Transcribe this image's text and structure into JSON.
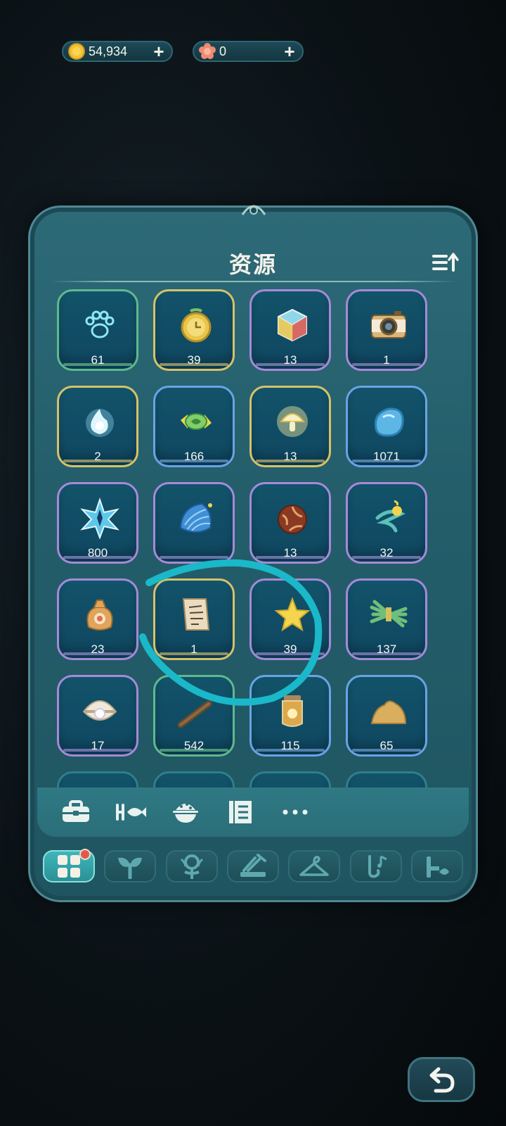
{
  "currencies": [
    {
      "name": "gold-coin",
      "value": "54,934",
      "icon": "coin-icon"
    },
    {
      "name": "flower-token",
      "value": "0",
      "icon": "flower-icon"
    }
  ],
  "panel": {
    "title": "资源",
    "items": [
      {
        "icon": "paw-icon",
        "count": "61",
        "rarity": "green"
      },
      {
        "icon": "pocket-watch-icon",
        "count": "39",
        "rarity": "yellow"
      },
      {
        "icon": "cube-icon",
        "count": "13",
        "rarity": "purple"
      },
      {
        "icon": "camera-icon",
        "count": "1",
        "rarity": "purple"
      },
      {
        "icon": "spirit-flame-icon",
        "count": "2",
        "rarity": "yellow"
      },
      {
        "icon": "candy-icon",
        "count": "166",
        "rarity": "blue"
      },
      {
        "icon": "glowing-mushroom-icon",
        "count": "13",
        "rarity": "yellow"
      },
      {
        "icon": "blue-slime-icon",
        "count": "1071",
        "rarity": "blue"
      },
      {
        "icon": "star-crystal-icon",
        "count": "800",
        "rarity": "purple"
      },
      {
        "icon": "blue-shell-icon",
        "count": "",
        "rarity": "purple"
      },
      {
        "icon": "chocolate-ball-icon",
        "count": "13",
        "rarity": "purple"
      },
      {
        "icon": "swirl-orb-icon",
        "count": "32",
        "rarity": "purple"
      },
      {
        "icon": "pouch-icon",
        "count": "23",
        "rarity": "purple"
      },
      {
        "icon": "paper-note-icon",
        "count": "1",
        "rarity": "yellow"
      },
      {
        "icon": "star-icon",
        "count": "39",
        "rarity": "purple"
      },
      {
        "icon": "grass-bundle-icon",
        "count": "137",
        "rarity": "purple"
      },
      {
        "icon": "pearl-oyster-icon",
        "count": "17",
        "rarity": "purple"
      },
      {
        "icon": "wood-stick-icon",
        "count": "542",
        "rarity": "green"
      },
      {
        "icon": "glow-jar-icon",
        "count": "115",
        "rarity": "blue"
      },
      {
        "icon": "sand-pile-icon",
        "count": "65",
        "rarity": "blue"
      }
    ],
    "sub_tabs": [
      "toolbox-icon",
      "fish-icon",
      "food-bowl-icon",
      "book-icon",
      "more-icon"
    ],
    "bottom_tabs": [
      "grid-icon",
      "sprout-icon",
      "flower-icon",
      "crafting-icon",
      "hanger-icon",
      "music-icon",
      "furniture-icon"
    ]
  },
  "colors": {
    "panel": "#245e6b",
    "cell": "#12536a",
    "rarity_green": "#5fb98e",
    "rarity_yellow": "#d6c26a",
    "rarity_purple": "#a58ad8",
    "rarity_blue": "#6aa3e6",
    "scribble": "#1ab8c8",
    "badge": "#e05a4c"
  }
}
